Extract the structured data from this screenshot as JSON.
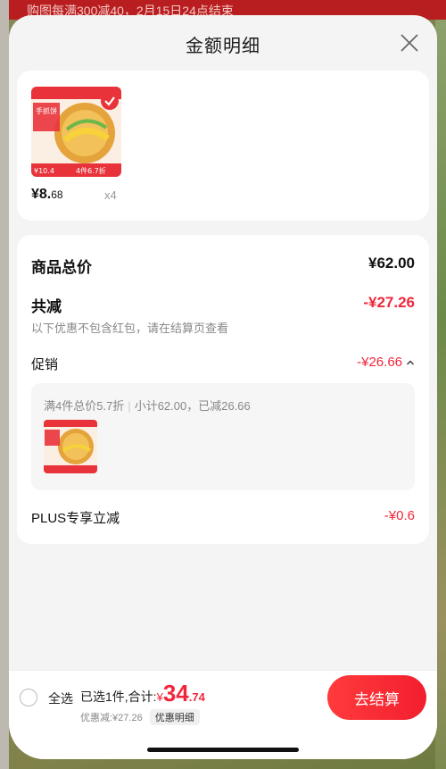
{
  "background": {
    "banner_text": "购图每满300减40，2月15日24点结束"
  },
  "header": {
    "title": "金额明细"
  },
  "product": {
    "price_main": "¥8.",
    "price_cents": "68",
    "quantity": "x4",
    "image_label": "手抓饼",
    "image_badge": "4件6.7折",
    "image_price": "¥10.4"
  },
  "summary": {
    "total_label": "商品总价",
    "total_value": "¥62.00",
    "reduce_label": "共减",
    "reduce_value": "-¥27.26",
    "reduce_note": "以下优惠不包含红包，请在结算页查看",
    "promo_label": "促销",
    "promo_value": "-¥26.66",
    "promo_desc_main": "满4件总价5.7折",
    "promo_desc_sep": "|",
    "promo_desc_sub": "小计62.00，已减26.66",
    "plus_label": "PLUS专享立减",
    "plus_value": "-¥0.6"
  },
  "bottom": {
    "select_all": "全选",
    "selected_text": "已选1件,合计:",
    "currency": "¥",
    "amount_int": "34",
    "amount_dec": ".74",
    "discount_text": "优惠减:¥27.26",
    "detail_link": "优惠明细",
    "checkout_label": "去结算"
  },
  "colors": {
    "accent": "#f0273b",
    "button": "#f21f2f"
  },
  "icons": {
    "close": "close-icon",
    "expand": "chevron-up-icon",
    "check": "check-badge-icon"
  }
}
